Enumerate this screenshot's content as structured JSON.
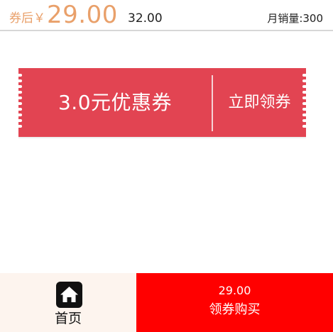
{
  "price_bar": {
    "after_coupon_label": "券后￥",
    "coupon_price": "29.00",
    "original_price": "32.00",
    "monthly_sales_label": "月销量:300"
  },
  "coupon": {
    "amount_text": "3.0元优惠券",
    "claim_label": "立即领券"
  },
  "bottom_bar": {
    "home_icon": "home-icon",
    "home_label": "首页",
    "buy_price": "29.00",
    "buy_label": "领券购买"
  },
  "colors": {
    "price_accent": "#e9a06a",
    "coupon_red": "#e24452",
    "buy_red": "#ff0000",
    "home_bg": "#fdf4ee"
  }
}
